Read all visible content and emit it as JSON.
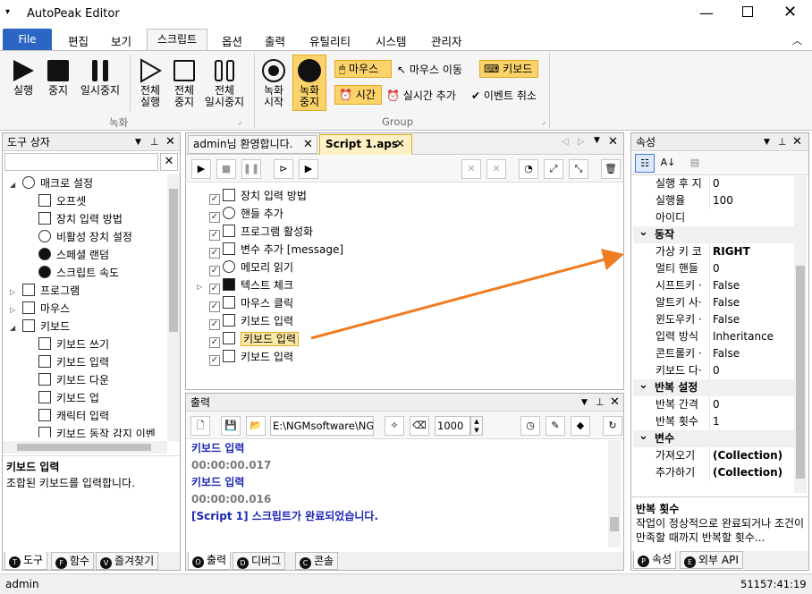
{
  "window": {
    "title": "AutoPeak Editor",
    "controls": [
      "minimize",
      "maximize",
      "close"
    ]
  },
  "menu": {
    "file": "File",
    "items": [
      "편집",
      "보기",
      "스크립트",
      "옵션",
      "출력",
      "유틸리티",
      "시스템",
      "관리자"
    ],
    "active": "스크립트"
  },
  "ribbon": {
    "record_group": {
      "run": "실행",
      "stop": "중지",
      "pause": "일시중지",
      "all_run": "전체\n실행",
      "all_stop": "전체\n중지",
      "all_pause": "전체\n일시중지",
      "label": "녹화"
    },
    "group2": {
      "rec_start": "녹화\n시작",
      "rec_stop": "녹화\n중지",
      "mouse": "마우스",
      "mouse_move": "마우스 이동",
      "keyboard": "키보드",
      "time": "시간",
      "realtime_add": "실시간 추가",
      "event_cancel": "이벤트 취소",
      "label": "Group"
    }
  },
  "toolbox": {
    "title": "도구 상자",
    "search_placeholder": "",
    "items": [
      {
        "label": "매크로 설정",
        "level": 0,
        "expanded": true,
        "icon": "globe-icon"
      },
      {
        "label": "오프셋",
        "level": 1,
        "icon": "offset-icon"
      },
      {
        "label": "장치 입력 방법",
        "level": 1,
        "icon": "device-input-icon"
      },
      {
        "label": "비활성 장치 설정",
        "level": 1,
        "icon": "crosshair-icon"
      },
      {
        "label": "스페셜 랜덤",
        "level": 1,
        "icon": "infinity-icon"
      },
      {
        "label": "스크립트 속도",
        "level": 1,
        "icon": "speed-icon"
      },
      {
        "label": "프로그램",
        "level": 0,
        "expanded": false,
        "icon": "program-icon"
      },
      {
        "label": "마우스",
        "level": 0,
        "expanded": false,
        "icon": "mouse-icon"
      },
      {
        "label": "키보드",
        "level": 0,
        "expanded": true,
        "icon": "keyboard-icon"
      },
      {
        "label": "키보드 쓰기",
        "level": 1,
        "icon": "book-icon"
      },
      {
        "label": "키보드 입력",
        "level": 1,
        "icon": "keyboard-icon"
      },
      {
        "label": "키보드 다운",
        "level": 1,
        "icon": "keyboard-down-icon"
      },
      {
        "label": "키보드 업",
        "level": 1,
        "icon": "keyboard-up-icon"
      },
      {
        "label": "캐릭터 입력",
        "level": 1,
        "icon": "char-input-icon"
      },
      {
        "label": "키보드 동작 감지 이벤",
        "level": 1,
        "icon": "lightning-icon"
      }
    ],
    "desc_title": "키보드 입력",
    "desc_text": "조합된 키보드를 입력합니다.",
    "tabs": [
      {
        "letter": "T",
        "label": "도구"
      },
      {
        "letter": "F",
        "label": "함수"
      },
      {
        "letter": "V",
        "label": "즐겨찾기"
      }
    ]
  },
  "editor": {
    "tabs": [
      {
        "label": "admin님 환영합니다.",
        "active": false
      },
      {
        "label": "Script 1.aps",
        "active": true
      }
    ],
    "items": [
      {
        "label": "장치 입력 방법",
        "icon": "device-input-icon"
      },
      {
        "label": "핸들 추가",
        "icon": "crosshair-icon"
      },
      {
        "label": "프로그램 활성화",
        "icon": "program-activate-icon"
      },
      {
        "label": "변수 추가 [message]",
        "icon": "variable-icon"
      },
      {
        "label": "메모리 읽기",
        "icon": "memory-icon"
      },
      {
        "label": "텍스트 체크",
        "icon": "text-check-icon",
        "expandable": true
      },
      {
        "label": "마우스 클릭",
        "icon": "mouse-click-icon"
      },
      {
        "label": "키보드 입력",
        "icon": "keyboard-icon"
      },
      {
        "label": "키보드 입력",
        "icon": "keyboard-icon",
        "selected": true
      },
      {
        "label": "키보드 입력",
        "icon": "keyboard-icon"
      }
    ]
  },
  "output": {
    "title": "출력",
    "path": "E:\\NGMsoftware\\NG",
    "count": "1000",
    "lines": [
      {
        "text": "키보드 입력",
        "style": "bold-blue"
      },
      {
        "text": "00:00:00.017",
        "style": "gray"
      },
      {
        "text": "키보드 입력",
        "style": "bold-blue"
      },
      {
        "text": "00:00:00.016",
        "style": "gray"
      },
      {
        "text": "[Script 1] 스크립트가 완료되었습니다.",
        "style": "blue"
      }
    ],
    "tabs": [
      {
        "letter": "O",
        "label": "출력"
      },
      {
        "letter": "D",
        "label": "디버그"
      },
      {
        "letter": "C",
        "label": "콘솔"
      }
    ]
  },
  "properties": {
    "title": "속성",
    "rows": [
      {
        "type": "prop",
        "key": "실행 후 지",
        "value": "0"
      },
      {
        "type": "prop",
        "key": "실행율",
        "value": "100"
      },
      {
        "type": "prop",
        "key": "아이디",
        "value": ""
      },
      {
        "type": "cat",
        "key": "동작"
      },
      {
        "type": "prop",
        "key": "가상 키 코",
        "value": "RIGHT",
        "bold": true
      },
      {
        "type": "prop",
        "key": "멀티 핸들",
        "value": "0"
      },
      {
        "type": "prop",
        "key": "시프트키 ·",
        "value": "False"
      },
      {
        "type": "prop",
        "key": "알트키 사·",
        "value": "False"
      },
      {
        "type": "prop",
        "key": "윈도우키 ·",
        "value": "False"
      },
      {
        "type": "prop",
        "key": "입력 방식",
        "value": "Inheritance"
      },
      {
        "type": "prop",
        "key": "콘트롤키 ·",
        "value": "False"
      },
      {
        "type": "prop",
        "key": "키보드 다·",
        "value": "0"
      },
      {
        "type": "cat",
        "key": "반복 설정"
      },
      {
        "type": "prop",
        "key": "반복 간격",
        "value": "0"
      },
      {
        "type": "prop",
        "key": "반복 횟수",
        "value": "1"
      },
      {
        "type": "cat",
        "key": "변수"
      },
      {
        "type": "prop",
        "key": "가져오기",
        "value": "(Collection)",
        "bold": true
      },
      {
        "type": "prop",
        "key": "추가하기",
        "value": "(Collection)",
        "bold": true
      }
    ],
    "desc_title": "반복 횟수",
    "desc_text": "작업이 정상적으로 완료되거나 조건이 만족할 때까지 반복할 횟수...",
    "tabs": [
      {
        "letter": "P",
        "label": "속성"
      },
      {
        "letter": "E",
        "label": "외부 API"
      }
    ]
  },
  "status": {
    "user": "admin",
    "time": "51157:41:19"
  },
  "colors": {
    "accent": "#2b66c4",
    "highlight": "#fbd36a",
    "arrow": "#f07c22",
    "output_blue": "#1b27b5"
  }
}
